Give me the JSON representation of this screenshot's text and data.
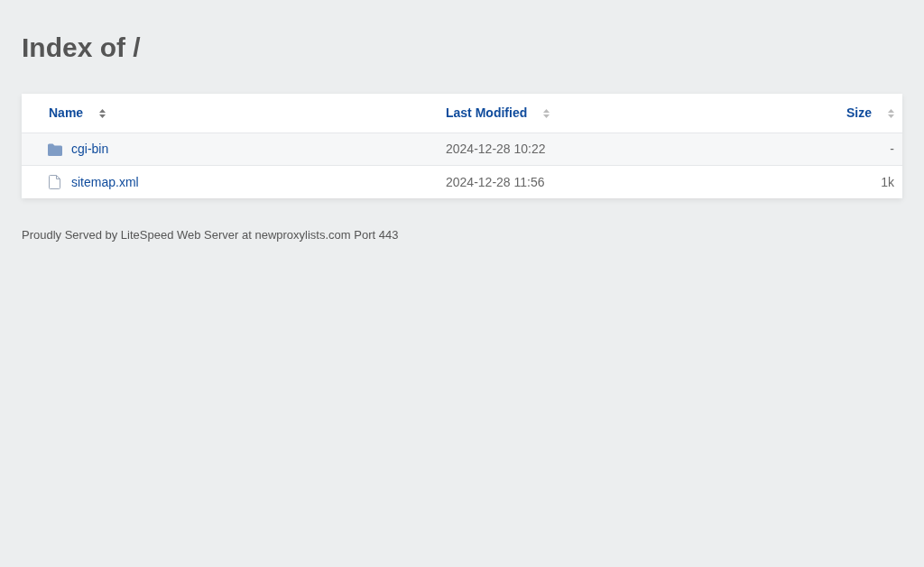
{
  "title": "Index of /",
  "table": {
    "columns": [
      {
        "label": "Name",
        "sorted": true
      },
      {
        "label": "Last Modified",
        "sorted": false
      },
      {
        "label": "Size",
        "sorted": false
      }
    ],
    "rows": [
      {
        "kind": "folder",
        "name": "cgi-bin",
        "modified": "2024-12-28 10:22",
        "size": "-"
      },
      {
        "kind": "file",
        "name": "sitemap.xml",
        "modified": "2024-12-28 11:56",
        "size": "1k"
      }
    ]
  },
  "footer": "Proudly Served by LiteSpeed Web Server at newproxylists.com Port 443"
}
